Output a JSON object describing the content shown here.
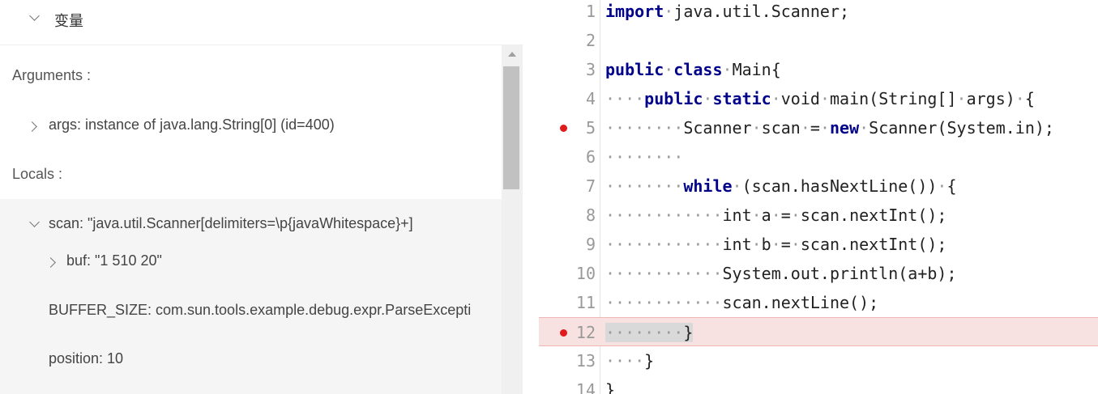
{
  "variables_panel": {
    "title": "变量",
    "arguments_label": "Arguments :",
    "args_item": "args: instance of java.lang.String[0] (id=400)",
    "locals_label": "Locals :",
    "scan_item": "scan: \"java.util.Scanner[delimiters=\\p{javaWhitespace}+]",
    "buf_item": "buf: \"1 510 20\"",
    "buffer_size_item": "BUFFER_SIZE: com.sun.tools.example.debug.expr.ParseException",
    "position_item": "position: 10"
  },
  "editor": {
    "lines": [
      {
        "num": "1",
        "parts": [
          {
            "k": "kw",
            "t": "import"
          },
          {
            "k": "ws",
            "t": "·"
          },
          {
            "k": "",
            "t": "java.util.Scanner;"
          }
        ]
      },
      {
        "num": "2",
        "parts": []
      },
      {
        "num": "3",
        "parts": [
          {
            "k": "kw",
            "t": "public"
          },
          {
            "k": "ws",
            "t": "·"
          },
          {
            "k": "kw",
            "t": "class"
          },
          {
            "k": "ws",
            "t": "·"
          },
          {
            "k": "",
            "t": "Main{"
          }
        ]
      },
      {
        "num": "4",
        "parts": [
          {
            "k": "ws",
            "t": "····"
          },
          {
            "k": "kw",
            "t": "public"
          },
          {
            "k": "ws",
            "t": "·"
          },
          {
            "k": "kw",
            "t": "static"
          },
          {
            "k": "ws",
            "t": "·"
          },
          {
            "k": "",
            "t": "void"
          },
          {
            "k": "ws",
            "t": "·"
          },
          {
            "k": "",
            "t": "main(String[]"
          },
          {
            "k": "ws",
            "t": "·"
          },
          {
            "k": "",
            "t": "args)"
          },
          {
            "k": "ws",
            "t": "·"
          },
          {
            "k": "",
            "t": "{"
          }
        ]
      },
      {
        "num": "5",
        "breakpoint": true,
        "parts": [
          {
            "k": "ws",
            "t": "········"
          },
          {
            "k": "",
            "t": "Scanner"
          },
          {
            "k": "ws",
            "t": "·"
          },
          {
            "k": "",
            "t": "scan"
          },
          {
            "k": "ws",
            "t": "·"
          },
          {
            "k": "",
            "t": "="
          },
          {
            "k": "ws",
            "t": "·"
          },
          {
            "k": "kw",
            "t": "new"
          },
          {
            "k": "ws",
            "t": "·"
          },
          {
            "k": "",
            "t": "Scanner(System.in);"
          }
        ]
      },
      {
        "num": "6",
        "parts": [
          {
            "k": "ws",
            "t": "········"
          }
        ]
      },
      {
        "num": "7",
        "parts": [
          {
            "k": "ws",
            "t": "········"
          },
          {
            "k": "kw",
            "t": "while"
          },
          {
            "k": "ws",
            "t": "·"
          },
          {
            "k": "",
            "t": "(scan.hasNextLine())"
          },
          {
            "k": "ws",
            "t": "·"
          },
          {
            "k": "",
            "t": "{"
          }
        ]
      },
      {
        "num": "8",
        "parts": [
          {
            "k": "ws",
            "t": "············"
          },
          {
            "k": "",
            "t": "int"
          },
          {
            "k": "ws",
            "t": "·"
          },
          {
            "k": "",
            "t": "a"
          },
          {
            "k": "ws",
            "t": "·"
          },
          {
            "k": "",
            "t": "="
          },
          {
            "k": "ws",
            "t": "·"
          },
          {
            "k": "",
            "t": "scan.nextInt();"
          }
        ]
      },
      {
        "num": "9",
        "parts": [
          {
            "k": "ws",
            "t": "············"
          },
          {
            "k": "",
            "t": "int"
          },
          {
            "k": "ws",
            "t": "·"
          },
          {
            "k": "",
            "t": "b"
          },
          {
            "k": "ws",
            "t": "·"
          },
          {
            "k": "",
            "t": "="
          },
          {
            "k": "ws",
            "t": "·"
          },
          {
            "k": "",
            "t": "scan.nextInt();"
          }
        ]
      },
      {
        "num": "10",
        "parts": [
          {
            "k": "ws",
            "t": "············"
          },
          {
            "k": "",
            "t": "System.out.println(a+b);"
          }
        ]
      },
      {
        "num": "11",
        "parts": [
          {
            "k": "ws",
            "t": "············"
          },
          {
            "k": "",
            "t": "scan.nextLine();"
          }
        ]
      },
      {
        "num": "12",
        "breakpoint": true,
        "current": true,
        "parts": [
          {
            "k": "ws sel",
            "t": "········"
          },
          {
            "k": "sel",
            "t": "}"
          }
        ]
      },
      {
        "num": "13",
        "parts": [
          {
            "k": "ws",
            "t": "····"
          },
          {
            "k": "",
            "t": "}"
          }
        ]
      },
      {
        "num": "14",
        "parts": [
          {
            "k": "",
            "t": "}"
          }
        ]
      }
    ]
  }
}
